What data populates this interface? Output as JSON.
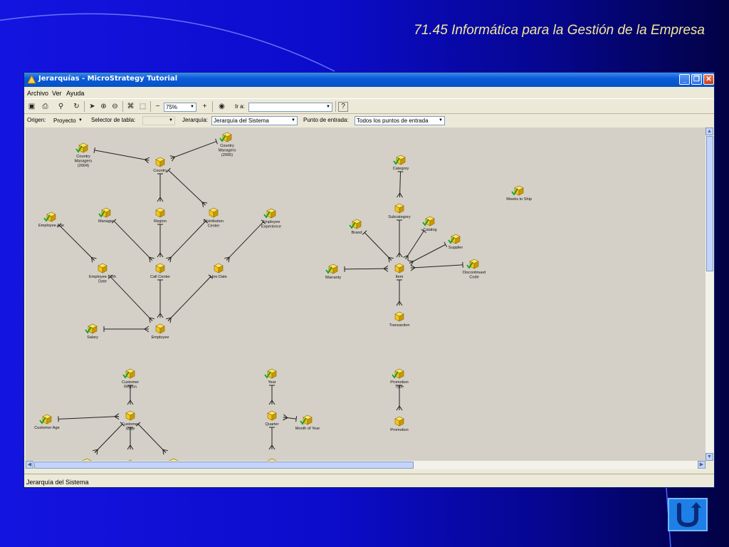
{
  "slide": {
    "title": "71.45 Informática para la Gestión de la Empresa"
  },
  "window": {
    "title": "Jerarquías - MicroStrategy Tutorial",
    "menu": [
      "Archivo",
      "Ver",
      "Ayuda"
    ],
    "toolbar": {
      "zoom": "75%",
      "goto_label": "Ir a:",
      "goto_value": ""
    },
    "filters": {
      "origin_label": "Origen:",
      "origin_value": "Proyecto",
      "table_label": "Selector de tabla:",
      "table_value": "",
      "hierarchy_label": "Jerarquía:",
      "hierarchy_value": "Jerarquía del Sistema",
      "entry_label": "Punto de entrada:",
      "entry_value": "Todos los puntos de entrada"
    },
    "status": "Jerarquía del Sistema"
  },
  "nodes": {
    "cm2004": [
      "Country",
      "Managers",
      "(2004)"
    ],
    "cm2005": [
      "Country",
      "Managers",
      "(2005)"
    ],
    "country": [
      "Country"
    ],
    "emp_age": [
      "Employee Age"
    ],
    "manager": [
      "Manager"
    ],
    "region": [
      "Region"
    ],
    "dist": [
      "Distribution",
      "Center"
    ],
    "emp_exp": [
      "Employee",
      "Experience"
    ],
    "emp_birth": [
      "Employee Birth",
      "Date"
    ],
    "callcenter": [
      "Call Center"
    ],
    "hire": [
      "Hire Date"
    ],
    "salary": [
      "Salary"
    ],
    "employee": [
      "Employee"
    ],
    "category": [
      "Category"
    ],
    "subcategory": [
      "Subcategory"
    ],
    "brand": [
      "Brand"
    ],
    "catalog": [
      "Catalog"
    ],
    "supplier": [
      "Supplier"
    ],
    "warranty": [
      "Warranty"
    ],
    "item": [
      "Item"
    ],
    "discontinued": [
      "Discontinued",
      "Code"
    ],
    "transaction": [
      "Transaction"
    ],
    "weeks": [
      "Weeks to Ship"
    ],
    "cust_region": [
      "Customer",
      "Region"
    ],
    "cust_state": [
      "Customer",
      "State"
    ],
    "cust_age": [
      "Customer Age"
    ],
    "year": [
      "Year"
    ],
    "quarter": [
      "Quarter"
    ],
    "month_of_year": [
      "Month of Year"
    ],
    "promo_type": [
      "Promotion",
      "Type"
    ],
    "promotion": [
      "Promotion"
    ]
  },
  "icons": {
    "window": "app-icon",
    "minimize": "minimize-icon",
    "maximize": "maximize-icon",
    "close": "close-icon",
    "attribute": "attribute-cube-icon",
    "nav": "return-arrow-icon"
  },
  "colors": {
    "slide_bg": "#0c0ccc",
    "title_text": "#f2e89a",
    "canvas_bg": "#d4d0c8",
    "cube": "#f5c518",
    "check": "#1aa01a"
  }
}
